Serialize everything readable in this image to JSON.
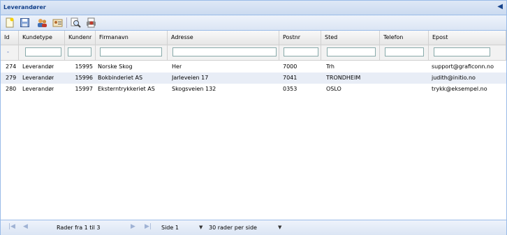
{
  "panel": {
    "title": "Leverandører"
  },
  "toolbar": {
    "buttons": [
      "new-icon",
      "save-icon",
      "users-icon",
      "card-icon",
      "search-icon",
      "print-icon"
    ]
  },
  "columns": {
    "id": "Id",
    "kundetype": "Kundetype",
    "kundenr": "Kundenr",
    "firmanavn": "Firmanavn",
    "adresse": "Adresse",
    "postnr": "Postnr",
    "sted": "Sted",
    "telefon": "Telefon",
    "epost": "Epost"
  },
  "filter": {
    "id": "-"
  },
  "rows": [
    {
      "id": "274",
      "kundetype": "Leverandør",
      "kundenr": "15995",
      "firmanavn": "Norske Skog",
      "adresse": "Her",
      "postnr": "7000",
      "sted": "Trh",
      "telefon": "",
      "epost": "support@graficonn.no"
    },
    {
      "id": "279",
      "kundetype": "Leverandør",
      "kundenr": "15996",
      "firmanavn": "Bokbinderiet AS",
      "adresse": "Jarleveien 17",
      "postnr": "7041",
      "sted": "TRONDHEIM",
      "telefon": "",
      "epost": "judith@initio.no"
    },
    {
      "id": "280",
      "kundetype": "Leverandør",
      "kundenr": "15997",
      "firmanavn": "Eksterntrykkeriet AS",
      "adresse": "Skogsveien 132",
      "postnr": "0353",
      "sted": "OSLO",
      "telefon": "",
      "epost": "trykk@eksempel.no"
    }
  ],
  "pager": {
    "rows_text": "Rader fra 1 til 3",
    "page": "Side 1",
    "per_page": "30 rader per side"
  },
  "colors": {
    "header_blue": "#15428b",
    "border_blue": "#99bbe8",
    "alt_row": "#e8edf6"
  }
}
